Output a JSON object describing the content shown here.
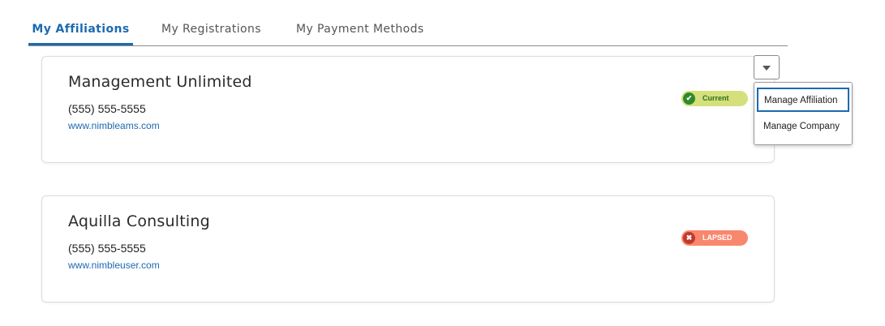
{
  "tabs": [
    {
      "label": "My Affiliations",
      "active": true
    },
    {
      "label": "My Registrations",
      "active": false
    },
    {
      "label": "My Payment Methods",
      "active": false
    }
  ],
  "affiliations": [
    {
      "name": "Management Unlimited",
      "phone": "(555) 555-5555",
      "website": "www.nimbleams.com",
      "status": {
        "label": "Current",
        "icon": "check-circle-icon",
        "bg_color": "#d5e07c",
        "text_color": "#2d6e1e"
      }
    },
    {
      "name": "Aquilla Consulting",
      "phone": "(555) 555-5555",
      "website": "www.nimbleuser.com",
      "status": {
        "label": "LAPSED",
        "icon": "x-circle-icon",
        "bg_color": "#f8876e",
        "text_color": "#ffffff"
      }
    }
  ],
  "dropdown": {
    "toggle_icon": "caret-down-icon",
    "items": [
      {
        "label": "Manage Affiliation",
        "focused": true
      },
      {
        "label": "Manage Company",
        "focused": false
      }
    ]
  },
  "colors": {
    "accent": "#1c6ab0"
  }
}
